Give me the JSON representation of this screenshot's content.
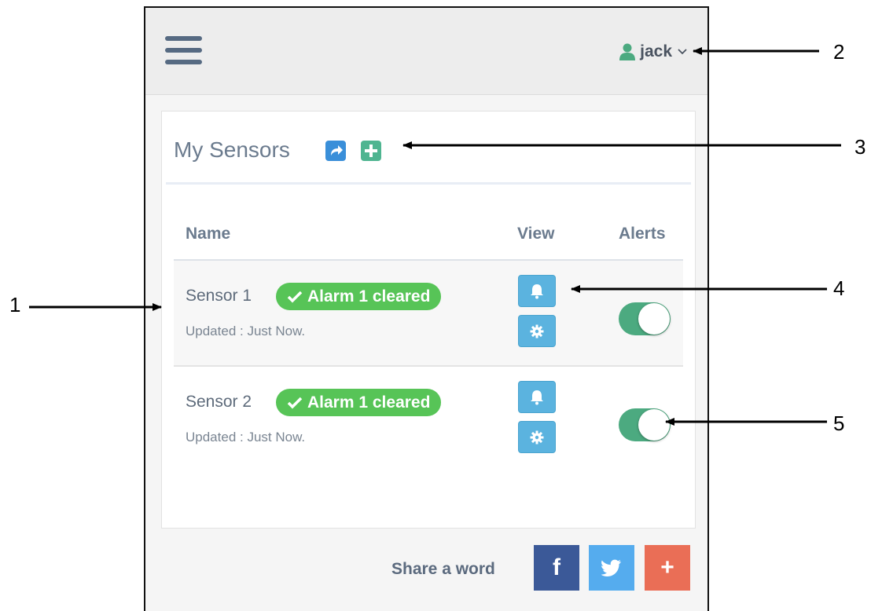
{
  "header": {
    "user_name": "jack",
    "user_icon": "user-icon",
    "dropdown_icon": "chevron-down-icon",
    "menu_icon": "hamburger-menu-icon"
  },
  "card": {
    "title": "My Sensors",
    "share_icon": "share-icon",
    "add_icon": "add-icon"
  },
  "table": {
    "columns": [
      "Name",
      "View",
      "Alerts"
    ],
    "rows": [
      {
        "name": "Sensor 1",
        "badge": "Alarm 1 cleared",
        "updated": "Updated : Just Now.",
        "alerts_on": true
      },
      {
        "name": "Sensor 2",
        "badge": "Alarm 1 cleared",
        "updated": "Updated : Just Now.",
        "alerts_on": true
      }
    ]
  },
  "footer": {
    "share_label": "Share a word",
    "facebook_glyph": "f",
    "googleplus_glyph": "+"
  },
  "callouts": [
    "1",
    "2",
    "3",
    "4",
    "5"
  ],
  "colors": {
    "badge_green": "#57c457",
    "toggle_on": "#4caa80",
    "view_button": "#5bb3df",
    "facebook": "#3b5998",
    "twitter": "#55acee",
    "googleplus": "#ea6e56"
  }
}
